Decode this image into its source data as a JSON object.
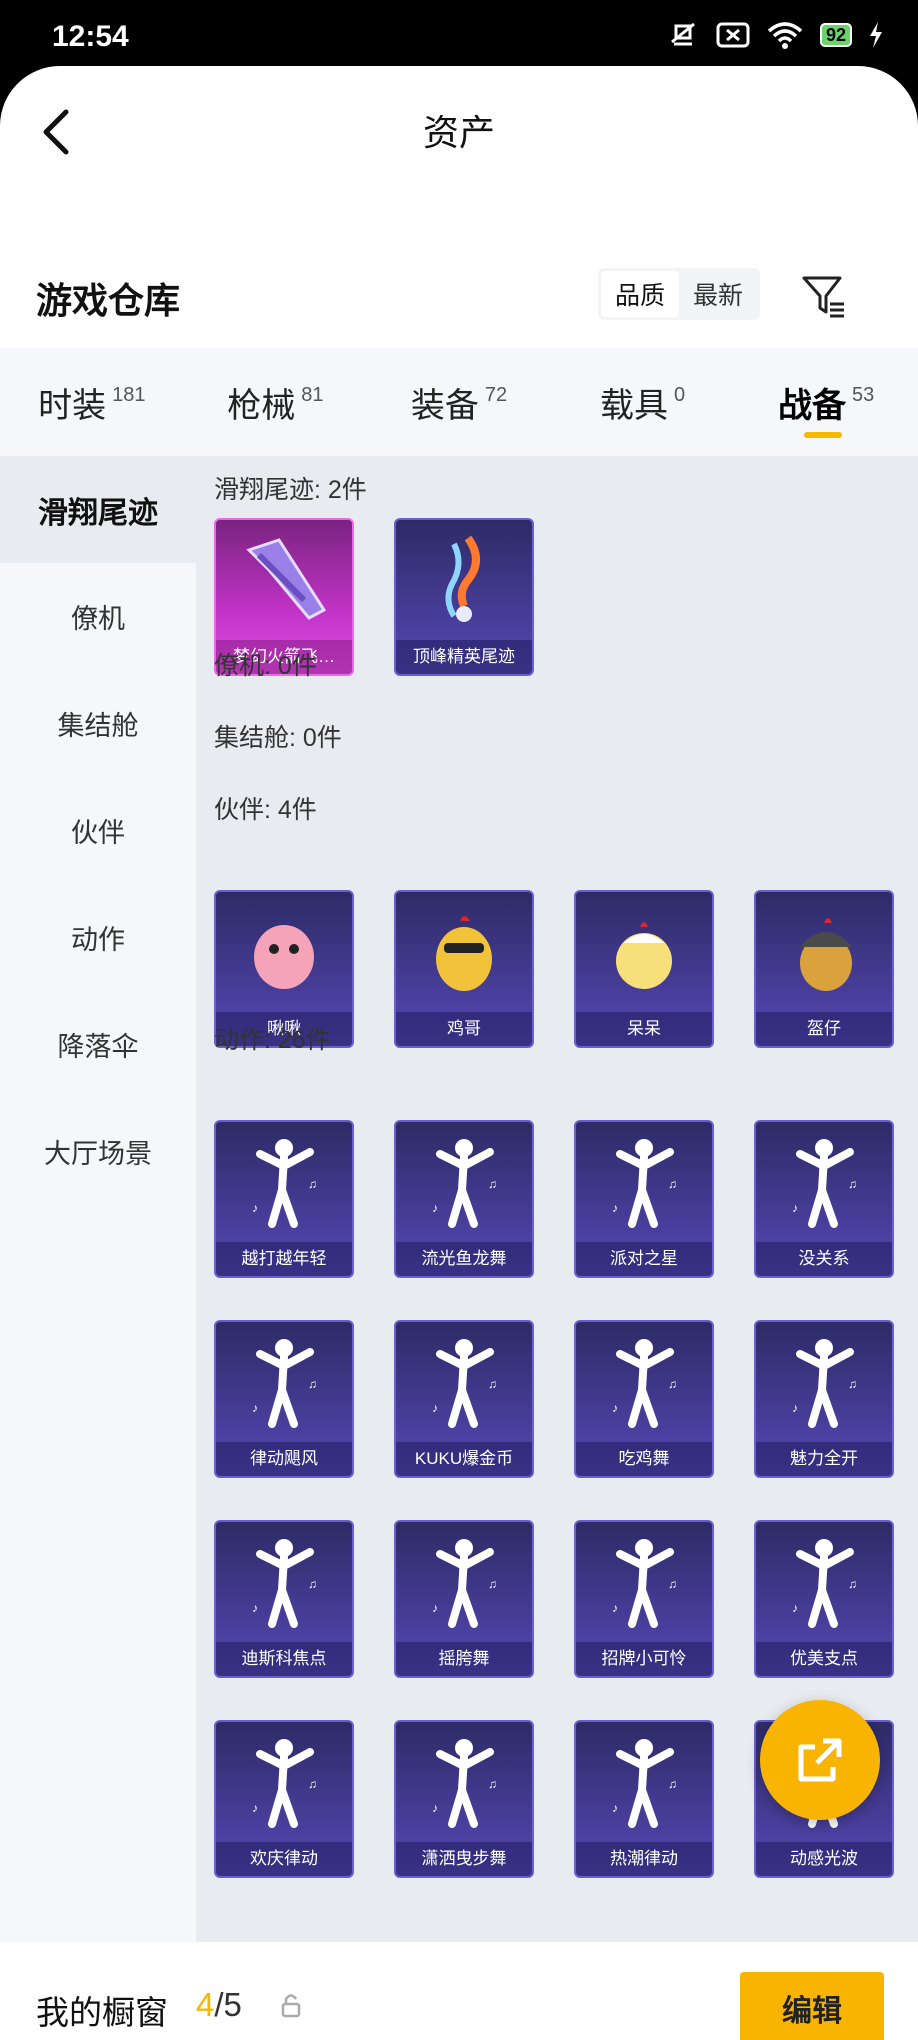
{
  "status_bar": {
    "time": "12:54",
    "battery": "92"
  },
  "header": {
    "title": "资产"
  },
  "warehouse": {
    "title": "游戏仓库",
    "sort_options": [
      "品质",
      "最新"
    ]
  },
  "tabs": [
    {
      "label": "时装",
      "count": "181"
    },
    {
      "label": "枪械",
      "count": "81"
    },
    {
      "label": "装备",
      "count": "72"
    },
    {
      "label": "载具",
      "count": "0"
    },
    {
      "label": "战备",
      "count": "53"
    }
  ],
  "active_tab": "战备",
  "sidebar": [
    "滑翔尾迹",
    "僚机",
    "集结舱",
    "伙伴",
    "动作",
    "降落伞",
    "大厅场景"
  ],
  "sections": {
    "glide": {
      "title": "滑翔尾迹: 2件",
      "items": [
        "梦幻火箭飞…",
        "顶峰精英尾迹"
      ]
    },
    "wingman": {
      "title": "僚机: 0件"
    },
    "pod": {
      "title": "集结舱: 0件"
    },
    "partner": {
      "title": "伙伴: 4件",
      "items": [
        "啾啾",
        "鸡哥",
        "呆呆",
        "盔仔"
      ]
    },
    "emote": {
      "title": "动作: 26件",
      "items": [
        "越打越年轻",
        "流光鱼龙舞",
        "派对之星",
        "没关系",
        "律动飓风",
        "KUKU爆金币",
        "吃鸡舞",
        "魅力全开",
        "迪斯科焦点",
        "摇胯舞",
        "招牌小可怜",
        "优美支点",
        "欢庆律动",
        "潇洒曳步舞",
        "热潮律动",
        "动感光波"
      ]
    }
  },
  "bottom": {
    "label": "我的橱窗",
    "current": "4",
    "sep": "/",
    "total": "5",
    "edit": "编辑"
  },
  "colors": {
    "accent": "#f8b400",
    "card_purple": "#4a3f9e",
    "card_pink": "#c233c8"
  }
}
